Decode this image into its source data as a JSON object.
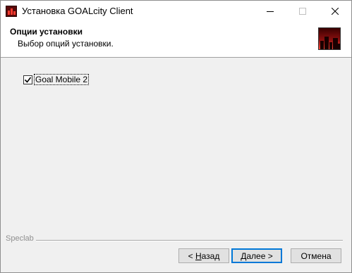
{
  "window": {
    "title": "Установка GOALcity Client",
    "icon": "app-icon"
  },
  "header": {
    "title": "Опции установки",
    "subtitle": "Выбор опций установки."
  },
  "options": [
    {
      "label": "Goal Mobile 2",
      "checked": true
    }
  ],
  "footer": {
    "brand": "Speclab",
    "back_accel": "Н",
    "back_rest": "азад",
    "back_prefix": "< ",
    "next_accel": "Д",
    "next_rest": "алее",
    "next_suffix": " >",
    "cancel_label": "Отмена"
  },
  "colors": {
    "focus_border": "#0078d7",
    "dialog_bg": "#f0f0f0"
  }
}
